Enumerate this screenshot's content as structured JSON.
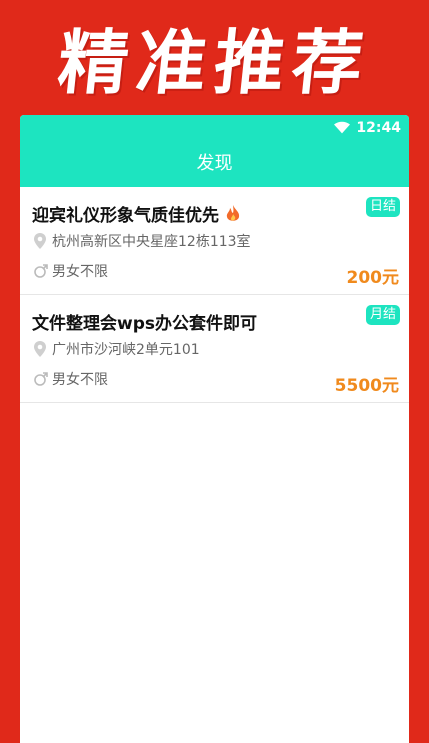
{
  "banner": {
    "title": "精准推荐"
  },
  "status": {
    "time": "12:44"
  },
  "header": {
    "title": "发现"
  },
  "jobs": [
    {
      "title": "迎宾礼仪形象气质佳优先",
      "hot": true,
      "badge": "日结",
      "address": "杭州高新区中央星座12栋113室",
      "gender": "男女不限",
      "price": "200元"
    },
    {
      "title": "文件整理会wps办公套件即可",
      "hot": false,
      "badge": "月结",
      "address": "广州市沙河峡2单元101",
      "gender": "男女不限",
      "price": "5500元"
    }
  ],
  "colors": {
    "accent": "#1de4c0",
    "price": "#f08a1d",
    "background": "#e0291a"
  }
}
